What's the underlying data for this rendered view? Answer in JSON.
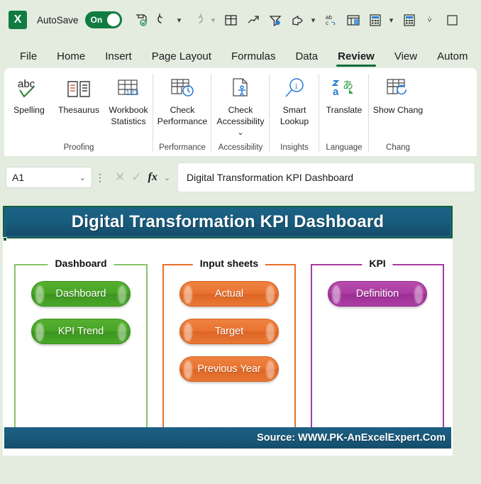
{
  "quick_access": {
    "app_icon": "excel-logo-icon",
    "autosave_label": "AutoSave",
    "autosave_state": "On",
    "icons": [
      {
        "name": "save-sync-icon",
        "glyph": "save"
      },
      {
        "name": "undo-icon",
        "glyph": "undo"
      },
      {
        "name": "undo-dropdown-chevron-icon",
        "glyph": "chevron"
      },
      {
        "name": "redo-icon",
        "glyph": "redo"
      },
      {
        "name": "redo-dropdown-chevron-icon",
        "glyph": "chevron"
      },
      {
        "name": "table-icon",
        "glyph": "table"
      },
      {
        "name": "pen-draw-icon",
        "glyph": "pen"
      },
      {
        "name": "filter-settings-icon",
        "glyph": "filter"
      },
      {
        "name": "share-icon",
        "glyph": "share"
      },
      {
        "name": "share-dropdown-chevron-icon",
        "glyph": "chevron"
      },
      {
        "name": "spelling-abc-icon",
        "glyph": "abc"
      },
      {
        "name": "freeze-panes-icon",
        "glyph": "freeze"
      },
      {
        "name": "calculator-icon",
        "glyph": "calc"
      },
      {
        "name": "calculator-dropdown-chevron-icon",
        "glyph": "chevron"
      },
      {
        "name": "calculator-two-icon",
        "glyph": "calc"
      },
      {
        "name": "customize-toolbar-chevron-icon",
        "glyph": "chevron-wide"
      },
      {
        "name": "new-window-icon",
        "glyph": "window"
      }
    ]
  },
  "ribbon_tabs": [
    {
      "label": "File",
      "active": false
    },
    {
      "label": "Home",
      "active": false
    },
    {
      "label": "Insert",
      "active": false
    },
    {
      "label": "Page Layout",
      "active": false
    },
    {
      "label": "Formulas",
      "active": false
    },
    {
      "label": "Data",
      "active": false
    },
    {
      "label": "Review",
      "active": true
    },
    {
      "label": "View",
      "active": false
    },
    {
      "label": "Autom",
      "active": false
    }
  ],
  "ribbon_groups": [
    {
      "name": "Proofing",
      "items": [
        {
          "label": "Spelling",
          "icon": "spelling-abc-check-icon",
          "has_caret": false
        },
        {
          "label": "Thesaurus",
          "icon": "thesaurus-book-icon",
          "has_caret": false
        },
        {
          "label": "Workbook Statistics",
          "icon": "workbook-statistics-icon",
          "has_caret": false
        }
      ]
    },
    {
      "name": "Performance",
      "items": [
        {
          "label": "Check Performance",
          "icon": "check-performance-icon",
          "has_caret": false
        }
      ]
    },
    {
      "name": "Accessibility",
      "items": [
        {
          "label": "Check Accessibility",
          "icon": "check-accessibility-icon",
          "has_caret": true
        }
      ]
    },
    {
      "name": "Insights",
      "items": [
        {
          "label": "Smart Lookup",
          "icon": "smart-lookup-icon",
          "has_caret": false
        }
      ]
    },
    {
      "name": "Language",
      "items": [
        {
          "label": "Translate",
          "icon": "translate-icon",
          "has_caret": false
        }
      ]
    },
    {
      "name": "Chang",
      "items": [
        {
          "label": "Show Chang",
          "icon": "show-changes-icon",
          "has_caret": false
        }
      ]
    }
  ],
  "formula_bar": {
    "name_box_value": "A1",
    "cancel_icon": "cancel-x-icon",
    "confirm_icon": "confirm-check-icon",
    "fx_label": "fx",
    "formula_value": "Digital Transformation KPI Dashboard"
  },
  "worksheet": {
    "title": "Digital Transformation KPI Dashboard",
    "panels": [
      {
        "legend": "Dashboard",
        "color": "#86c46a",
        "style": "green",
        "buttons": [
          {
            "label": "Dashboard"
          },
          {
            "label": "KPI Trend"
          }
        ]
      },
      {
        "legend": "Input sheets",
        "color": "#e8702a",
        "style": "orange",
        "buttons": [
          {
            "label": "Actual"
          },
          {
            "label": "Target"
          },
          {
            "label": "Previous Year"
          }
        ]
      },
      {
        "legend": "KPI",
        "color": "#a83a9e",
        "style": "purple",
        "buttons": [
          {
            "label": "Definition"
          }
        ]
      }
    ],
    "source": "Source: WWW.PK-AnExcelExpert.Com"
  },
  "colors": {
    "app_bg": "#e3ecdf",
    "excel_green": "#107c41",
    "title_blue": "#185d7f",
    "green_button": "#47a425",
    "orange_button": "#e87331",
    "purple_button": "#ab3ca2",
    "active_tab_underline": "#0f6c3b"
  }
}
